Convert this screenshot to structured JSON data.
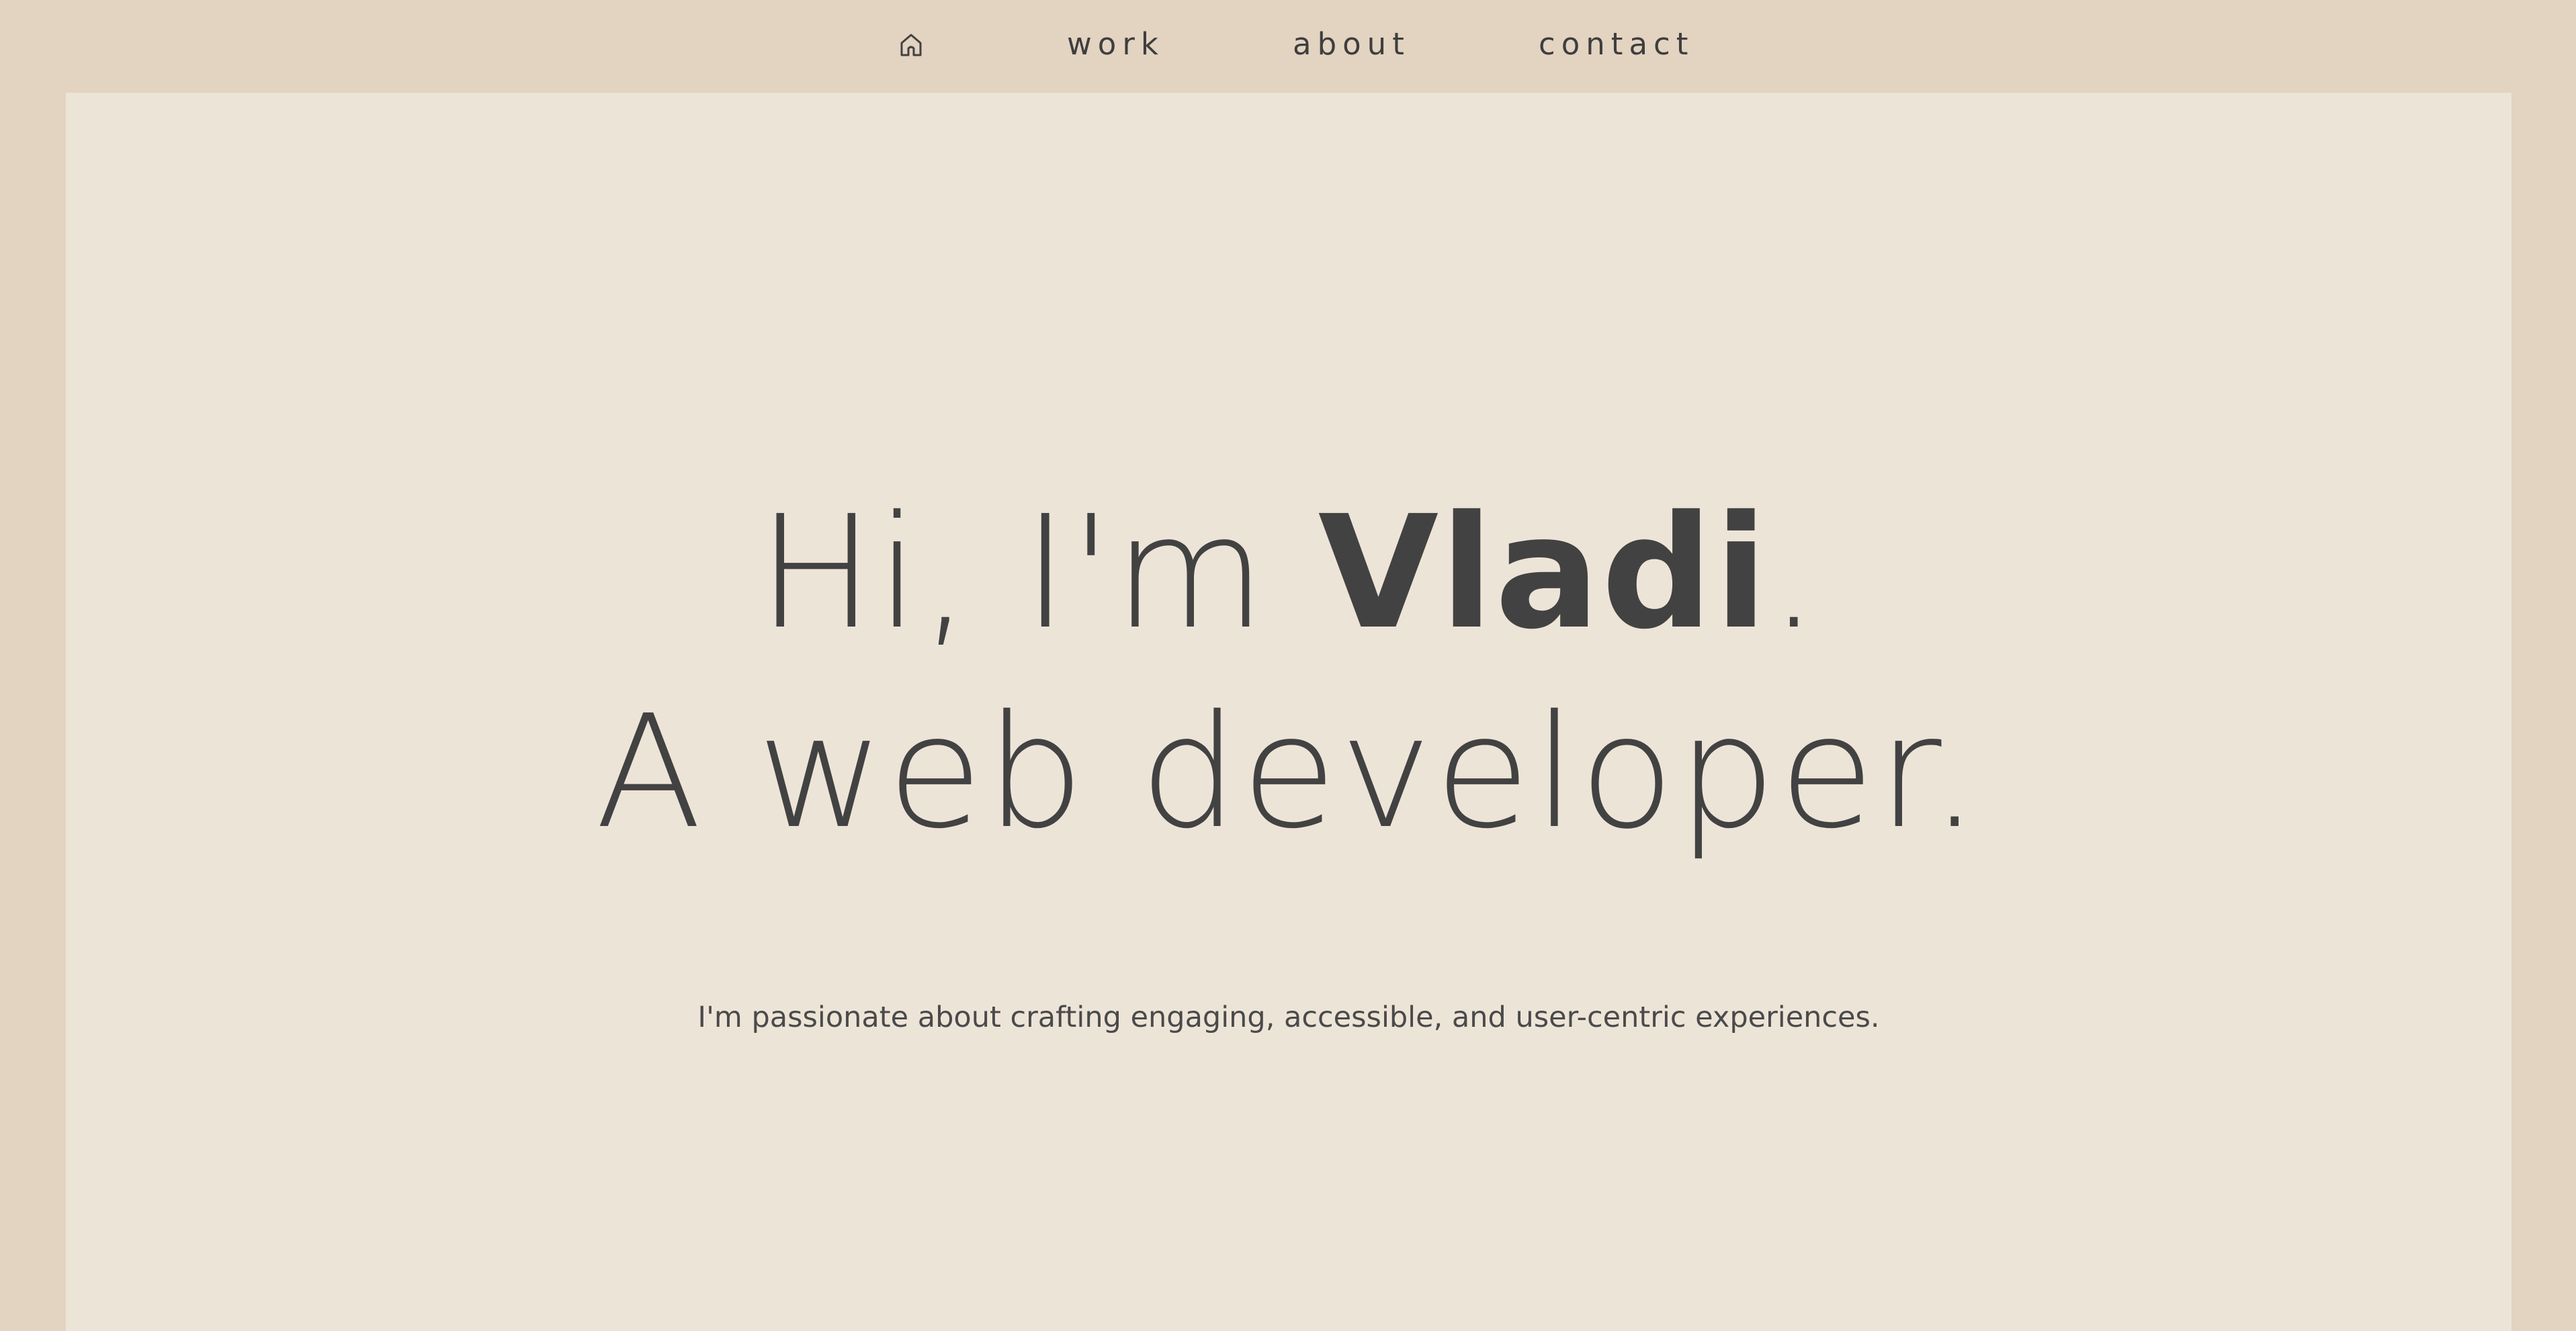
{
  "nav": {
    "home_icon": "house-icon",
    "items": [
      {
        "label": "work"
      },
      {
        "label": "about"
      },
      {
        "label": "contact"
      }
    ]
  },
  "hero": {
    "greeting_prefix": "Hi, I'm ",
    "name": "Vladi",
    "greeting_suffix": ".",
    "role": "A web developer.",
    "tagline": "I'm passionate about crafting engaging, accessible, and user-centric experiences."
  },
  "colors": {
    "outer_background": "#e3d3c1",
    "panel_background": "#ede4d8",
    "text": "#424242"
  }
}
